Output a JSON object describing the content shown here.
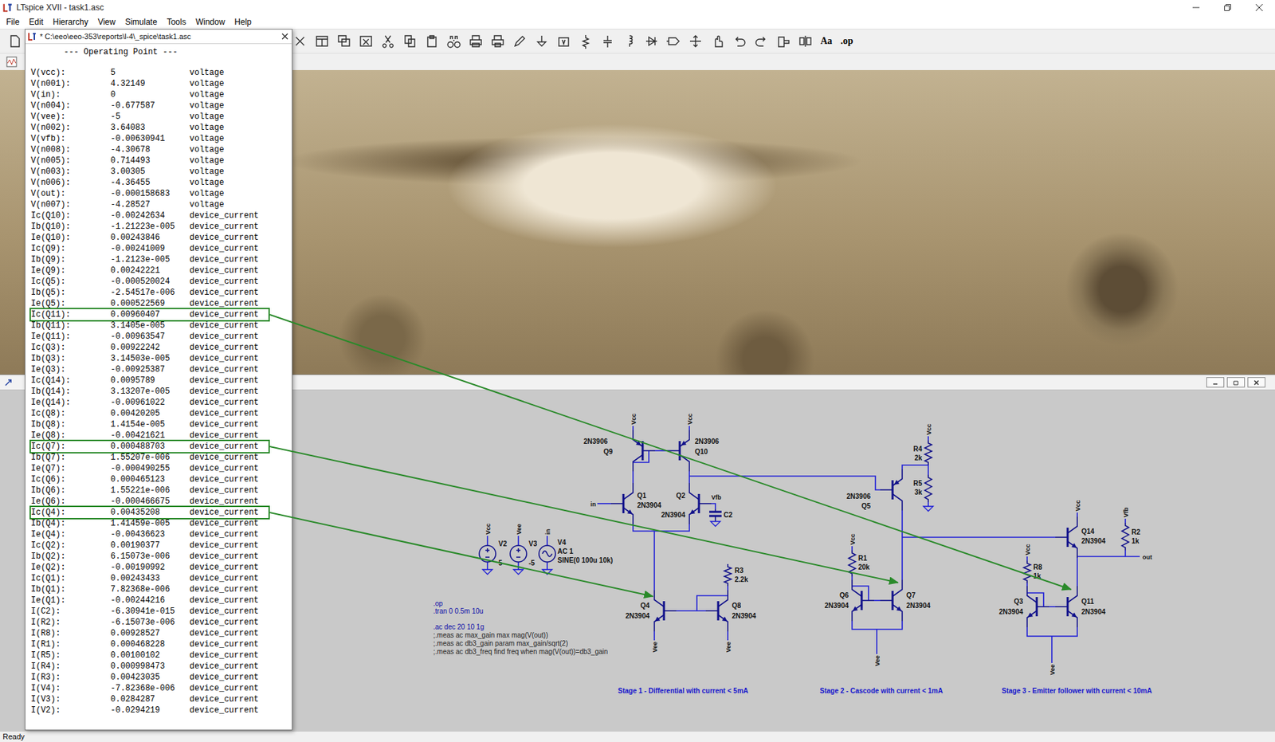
{
  "window": {
    "title": "LTspice XVII - task1.asc"
  },
  "menu": [
    "File",
    "Edit",
    "Hierarchy",
    "View",
    "Simulate",
    "Tools",
    "Window",
    "Help"
  ],
  "toolbar": {
    "text_buttons": [
      "Aa",
      ".op"
    ]
  },
  "op_window": {
    "title": "* C:\\eeo\\eeo-353\\reports\\l-4\\_spice\\task1.asc",
    "heading": "--- Operating Point ---",
    "rows": [
      {
        "name": "V(vcc):",
        "value": "5",
        "type": "voltage",
        "highlighted": false
      },
      {
        "name": "V(n001):",
        "value": "4.32149",
        "type": "voltage",
        "highlighted": false
      },
      {
        "name": "V(in):",
        "value": "0",
        "type": "voltage",
        "highlighted": false
      },
      {
        "name": "V(n004):",
        "value": "-0.677587",
        "type": "voltage",
        "highlighted": false
      },
      {
        "name": "V(vee):",
        "value": "-5",
        "type": "voltage",
        "highlighted": false
      },
      {
        "name": "V(n002):",
        "value": "3.64083",
        "type": "voltage",
        "highlighted": false
      },
      {
        "name": "V(vfb):",
        "value": "-0.00630941",
        "type": "voltage",
        "highlighted": false
      },
      {
        "name": "V(n008):",
        "value": "-4.30678",
        "type": "voltage",
        "highlighted": false
      },
      {
        "name": "V(n005):",
        "value": "0.714493",
        "type": "voltage",
        "highlighted": false
      },
      {
        "name": "V(n003):",
        "value": "3.00305",
        "type": "voltage",
        "highlighted": false
      },
      {
        "name": "V(n006):",
        "value": "-4.36455",
        "type": "voltage",
        "highlighted": false
      },
      {
        "name": "V(out):",
        "value": "-0.000158683",
        "type": "voltage",
        "highlighted": false
      },
      {
        "name": "V(n007):",
        "value": "-4.28527",
        "type": "voltage",
        "highlighted": false
      },
      {
        "name": "Ic(Q10):",
        "value": "-0.00242634",
        "type": "device_current",
        "highlighted": false
      },
      {
        "name": "Ib(Q10):",
        "value": "-1.21223e-005",
        "type": "device_current",
        "highlighted": false
      },
      {
        "name": "Ie(Q10):",
        "value": "0.00243846",
        "type": "device_current",
        "highlighted": false
      },
      {
        "name": "Ic(Q9):",
        "value": "-0.00241009",
        "type": "device_current",
        "highlighted": false
      },
      {
        "name": "Ib(Q9):",
        "value": "-1.2123e-005",
        "type": "device_current",
        "highlighted": false
      },
      {
        "name": "Ie(Q9):",
        "value": "0.00242221",
        "type": "device_current",
        "highlighted": false
      },
      {
        "name": "Ic(Q5):",
        "value": "-0.000520024",
        "type": "device_current",
        "highlighted": false
      },
      {
        "name": "Ib(Q5):",
        "value": "-2.54517e-006",
        "type": "device_current",
        "highlighted": false
      },
      {
        "name": "Ie(Q5):",
        "value": "0.000522569",
        "type": "device_current",
        "highlighted": false
      },
      {
        "name": "Ic(Q11):",
        "value": "0.00960407",
        "type": "device_current",
        "highlighted": true
      },
      {
        "name": "Ib(Q11):",
        "value": "3.1405e-005",
        "type": "device_current",
        "highlighted": false
      },
      {
        "name": "Ie(Q11):",
        "value": "-0.00963547",
        "type": "device_current",
        "highlighted": false
      },
      {
        "name": "Ic(Q3):",
        "value": "0.00922242",
        "type": "device_current",
        "highlighted": false
      },
      {
        "name": "Ib(Q3):",
        "value": "3.14503e-005",
        "type": "device_current",
        "highlighted": false
      },
      {
        "name": "Ie(Q3):",
        "value": "-0.00925387",
        "type": "device_current",
        "highlighted": false
      },
      {
        "name": "Ic(Q14):",
        "value": "0.0095789",
        "type": "device_current",
        "highlighted": false
      },
      {
        "name": "Ib(Q14):",
        "value": "3.13207e-005",
        "type": "device_current",
        "highlighted": false
      },
      {
        "name": "Ie(Q14):",
        "value": "-0.00961022",
        "type": "device_current",
        "highlighted": false
      },
      {
        "name": "Ic(Q8):",
        "value": "0.00420205",
        "type": "device_current",
        "highlighted": false
      },
      {
        "name": "Ib(Q8):",
        "value": "1.4154e-005",
        "type": "device_current",
        "highlighted": false
      },
      {
        "name": "Ie(Q8):",
        "value": "-0.00421621",
        "type": "device_current",
        "highlighted": false
      },
      {
        "name": "Ic(Q7):",
        "value": "0.000488703",
        "type": "device_current",
        "highlighted": true
      },
      {
        "name": "Ib(Q7):",
        "value": "1.55207e-006",
        "type": "device_current",
        "highlighted": false
      },
      {
        "name": "Ie(Q7):",
        "value": "-0.000490255",
        "type": "device_current",
        "highlighted": false
      },
      {
        "name": "Ic(Q6):",
        "value": "0.000465123",
        "type": "device_current",
        "highlighted": false
      },
      {
        "name": "Ib(Q6):",
        "value": "1.55221e-006",
        "type": "device_current",
        "highlighted": false
      },
      {
        "name": "Ie(Q6):",
        "value": "-0.000466675",
        "type": "device_current",
        "highlighted": false
      },
      {
        "name": "Ic(Q4):",
        "value": "0.00435208",
        "type": "device_current",
        "highlighted": true
      },
      {
        "name": "Ib(Q4):",
        "value": "1.41459e-005",
        "type": "device_current",
        "highlighted": false
      },
      {
        "name": "Ie(Q4):",
        "value": "-0.00436623",
        "type": "device_current",
        "highlighted": false
      },
      {
        "name": "Ic(Q2):",
        "value": "0.00190377",
        "type": "device_current",
        "highlighted": false
      },
      {
        "name": "Ib(Q2):",
        "value": "6.15073e-006",
        "type": "device_current",
        "highlighted": false
      },
      {
        "name": "Ie(Q2):",
        "value": "-0.00190992",
        "type": "device_current",
        "highlighted": false
      },
      {
        "name": "Ic(Q1):",
        "value": "0.00243433",
        "type": "device_current",
        "highlighted": false
      },
      {
        "name": "Ib(Q1):",
        "value": "7.82368e-006",
        "type": "device_current",
        "highlighted": false
      },
      {
        "name": "Ie(Q1):",
        "value": "-0.00244216",
        "type": "device_current",
        "highlighted": false
      },
      {
        "name": "I(C2):",
        "value": "-6.30941e-015",
        "type": "device_current",
        "highlighted": false
      },
      {
        "name": "I(R2):",
        "value": "-6.15073e-006",
        "type": "device_current",
        "highlighted": false
      },
      {
        "name": "I(R8):",
        "value": "0.00928527",
        "type": "device_current",
        "highlighted": false
      },
      {
        "name": "I(R1):",
        "value": "0.000468228",
        "type": "device_current",
        "highlighted": false
      },
      {
        "name": "I(R5):",
        "value": "0.00100102",
        "type": "device_current",
        "highlighted": false
      },
      {
        "name": "I(R4):",
        "value": "0.000998473",
        "type": "device_current",
        "highlighted": false
      },
      {
        "name": "I(R3):",
        "value": "0.00423035",
        "type": "device_current",
        "highlighted": false
      },
      {
        "name": "I(V4):",
        "value": "-7.82368e-006",
        "type": "device_current",
        "highlighted": false
      },
      {
        "name": "I(V3):",
        "value": "0.0284287",
        "type": "device_current",
        "highlighted": false
      },
      {
        "name": "I(V2):",
        "value": "-0.0294219",
        "type": "device_current",
        "highlighted": false
      }
    ]
  },
  "schematic": {
    "components": [
      {
        "name": "Q9",
        "model": "2N3906",
        "kind": "pnp"
      },
      {
        "name": "Q10",
        "model": "2N3906",
        "kind": "pnp"
      },
      {
        "name": "Q1",
        "model": "2N3904",
        "kind": "npn"
      },
      {
        "name": "Q2",
        "model": "2N3904",
        "kind": "npn"
      },
      {
        "name": "Q5",
        "model": "2N3906",
        "kind": "pnp"
      },
      {
        "name": "Q4",
        "model": "2N3904",
        "kind": "npn"
      },
      {
        "name": "Q8",
        "model": "2N3904",
        "kind": "npn"
      },
      {
        "name": "Q6",
        "model": "2N3904",
        "kind": "npn"
      },
      {
        "name": "Q7",
        "model": "2N3904",
        "kind": "npn"
      },
      {
        "name": "Q3",
        "model": "2N3904",
        "kind": "npn"
      },
      {
        "name": "Q11",
        "model": "2N3904",
        "kind": "npn"
      },
      {
        "name": "Q14",
        "model": "2N3904",
        "kind": "npn"
      },
      {
        "name": "R4",
        "value": "2k",
        "kind": "resistor"
      },
      {
        "name": "R5",
        "value": "3k",
        "kind": "resistor"
      },
      {
        "name": "R3",
        "value": "2.2k",
        "kind": "resistor"
      },
      {
        "name": "R1",
        "value": "20k",
        "kind": "resistor"
      },
      {
        "name": "R8",
        "value": "1k",
        "kind": "resistor"
      },
      {
        "name": "R2",
        "value": "1k",
        "kind": "resistor"
      },
      {
        "name": "C2",
        "kind": "capacitor"
      },
      {
        "name": "V2",
        "value": "5",
        "kind": "source"
      },
      {
        "name": "V3",
        "value": "-5",
        "kind": "source"
      },
      {
        "name": "V4",
        "value": "AC 1",
        "spec": "SINE(0 100u 10k)",
        "kind": "source"
      }
    ],
    "net_labels": [
      "Vcc",
      "Vcc",
      "Vcc",
      "Vcc",
      "Vcc",
      "Vcc",
      "Vcc",
      "Vee",
      "in",
      "Vee",
      "Vee",
      "Vee",
      "Vee",
      "Vfb",
      "in",
      "Vfb",
      "out"
    ],
    "directives": [
      {
        "text": ".op",
        "commented": false
      },
      {
        "text": ".tran 0 0.5m 10u",
        "commented": false
      },
      {
        "text": ".ac dec 20 10 1g",
        "commented": false
      },
      {
        "text": ";.meas ac max_gain max mag(V(out))",
        "commented": true
      },
      {
        "text": ";.meas ac db3_gain param max_gain/sqrt(2)",
        "commented": true
      },
      {
        "text": ";.meas ac db3_freq  find freq when mag(V(out))=db3_gain",
        "commented": true
      }
    ],
    "stage_labels": [
      "Stage 1 - Differential with current < 5mA",
      "Stage 2 - Cascode with current < 1mA",
      "Stage 3 - Emitter follower with current < 10mA"
    ]
  },
  "status_bar": "Ready"
}
